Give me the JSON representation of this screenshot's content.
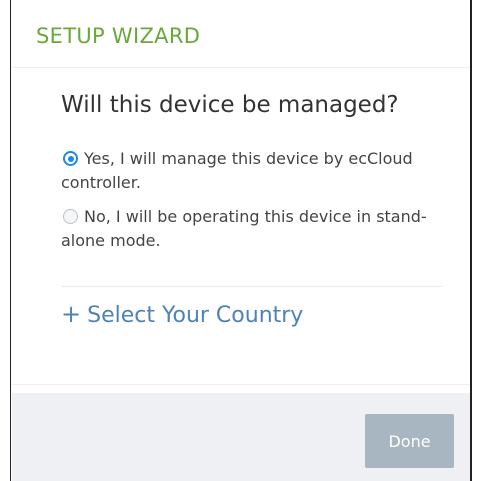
{
  "header": {
    "title": "SETUP WIZARD"
  },
  "question": "Will this device be managed?",
  "options": [
    {
      "label": "Yes, I will manage this device by ecCloud controller.",
      "selected": true
    },
    {
      "label": "No, I will be operating this device in stand-alone mode.",
      "selected": false
    }
  ],
  "country": {
    "icon": "plus-icon",
    "plus": "+",
    "label": "Select Your Country"
  },
  "footer": {
    "done_label": "Done"
  },
  "colors": {
    "title_green": "#6aa839",
    "link_blue": "#4f82b5",
    "radio_blue": "#1e88e5",
    "button_disabled": "#a8b6c1",
    "footer_bg": "#eef0f4"
  }
}
